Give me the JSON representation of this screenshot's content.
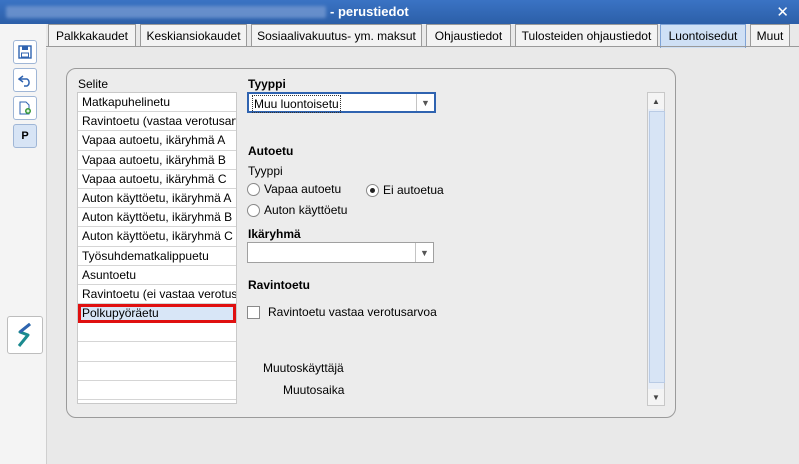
{
  "window": {
    "title": "- perustiedot",
    "close_icon": "close-icon"
  },
  "toolbar": {
    "p_label": "P"
  },
  "tabs": [
    {
      "label": "Palkkakaudet"
    },
    {
      "label": "Keskiansiokaudet"
    },
    {
      "label": "Sosiaalivakuutus- ym. maksut"
    },
    {
      "label": "Ohjaustiedot"
    },
    {
      "label": "Tulosteiden ohjaustiedot"
    },
    {
      "label": "Luontoisedut"
    },
    {
      "label": "Muut"
    }
  ],
  "list": {
    "header": "Selite",
    "items": [
      "Matkapuhelinetu",
      "Ravintoetu (vastaa verotusarvo",
      "Vapaa autoetu, ikäryhmä A",
      "Vapaa autoetu, ikäryhmä B",
      "Vapaa autoetu, ikäryhmä C",
      "Auton käyttöetu, ikäryhmä A",
      "Auton käyttöetu, ikäryhmä B",
      "Auton käyttöetu, ikäryhmä C",
      "Työsuhdematkalippuetu",
      "Asuntoetu",
      "Ravintoetu (ei vastaa verotusarvoa",
      "Polkupyöräetu"
    ],
    "selected_index": 11
  },
  "form": {
    "tyyppi_label": "Tyyppi",
    "tyyppi_value": "Muu luontoisetu",
    "autoetu_title": "Autoetu",
    "autoetu_tyyppi_label": "Tyyppi",
    "radio_vapaa": "Vapaa autoetu",
    "radio_ei": "Ei autoetua",
    "radio_kaytto": "Auton käyttöetu",
    "ikaryhma_label": "Ikäryhmä",
    "ikaryhma_value": "",
    "ravintoetu_title": "Ravintoetu",
    "ravintoetu_check": "Ravintoetu vastaa verotusarvoa",
    "muutoskayttaja_label": "Muutoskäyttäjä",
    "muutosaika_label": "Muutosaika"
  }
}
